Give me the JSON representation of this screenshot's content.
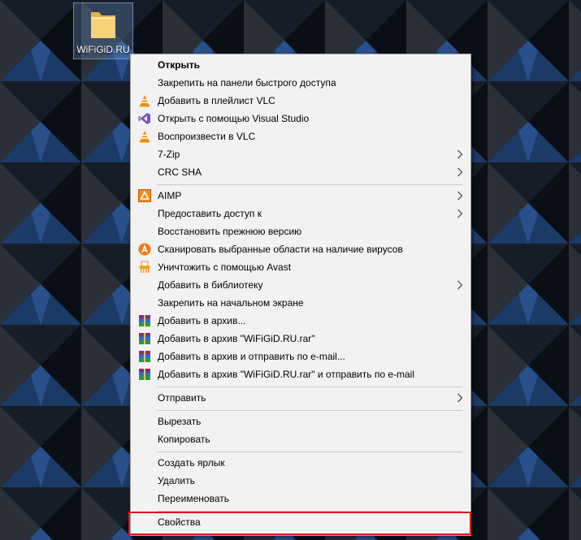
{
  "desktop": {
    "folder_label": "WiFiGiD.RU"
  },
  "menu": {
    "open": "Открыть",
    "pin_quick_access": "Закрепить на панели быстрого доступа",
    "add_vlc_playlist": "Добавить в плейлист VLC",
    "open_visual_studio": "Открыть с помощью Visual Studio",
    "play_vlc": "Воспроизвести в VLC",
    "seven_zip": "7-Zip",
    "crc_sha": "CRC SHA",
    "aimp": "AIMP",
    "share": "Предоставить доступ к",
    "restore_previous": "Восстановить прежнюю версию",
    "avast_scan": "Сканировать выбранные области на наличие вирусов",
    "avast_shred": "Уничтожить с помощью Avast",
    "add_library": "Добавить в библиотеку",
    "pin_start": "Закрепить на начальном экране",
    "add_archive": "Добавить в архив...",
    "add_archive_rar": "Добавить в архив \"WiFiGiD.RU.rar\"",
    "add_archive_email": "Добавить в архив и отправить по e-mail...",
    "add_archive_rar_email": "Добавить в архив \"WiFiGiD.RU.rar\" и отправить по e-mail",
    "send_to": "Отправить",
    "cut": "Вырезать",
    "copy": "Копировать",
    "create_shortcut": "Создать ярлык",
    "delete": "Удалить",
    "rename": "Переименовать",
    "properties": "Свойства"
  },
  "colors": {
    "highlight_border": "#e0161c",
    "menu_background": "#f2f2f2"
  }
}
